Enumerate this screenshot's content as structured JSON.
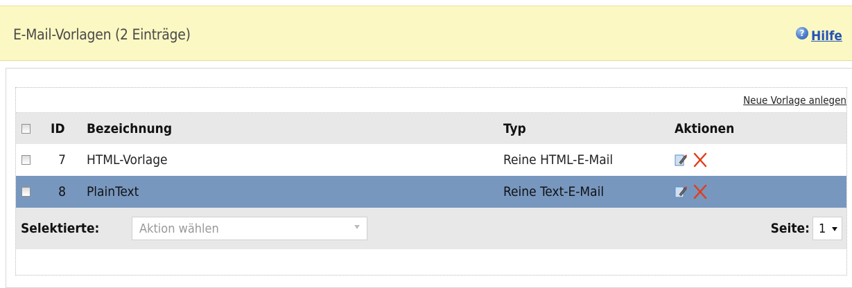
{
  "header": {
    "title": "E-Mail-Vorlagen (2 Einträge)",
    "help_label": "Hilfe",
    "help_icon": "help-icon"
  },
  "toolbar": {
    "new_template_link": "Neue Vorlage anlegen"
  },
  "table": {
    "columns": [
      "ID",
      "Bezeichnung",
      "Typ",
      "Aktionen"
    ],
    "rows": [
      {
        "id": "7",
        "name": "HTML-Vorlage",
        "type": "Reine HTML-E-Mail",
        "selected": false,
        "actions": [
          "edit-icon",
          "delete-icon"
        ]
      },
      {
        "id": "8",
        "name": "PlainText",
        "type": "Reine Text-E-Mail",
        "selected": true,
        "actions": [
          "edit-icon",
          "delete-icon"
        ]
      }
    ]
  },
  "footer": {
    "selected_label": "Selektierte:",
    "action_select_placeholder": "Aktion wählen",
    "page_label": "Seite:",
    "page_value": "1"
  },
  "colors": {
    "header_background": "#fbf8c3",
    "selected_row": "#7797bf",
    "link": "#2453b7",
    "delete_icon": "#e33b19"
  }
}
